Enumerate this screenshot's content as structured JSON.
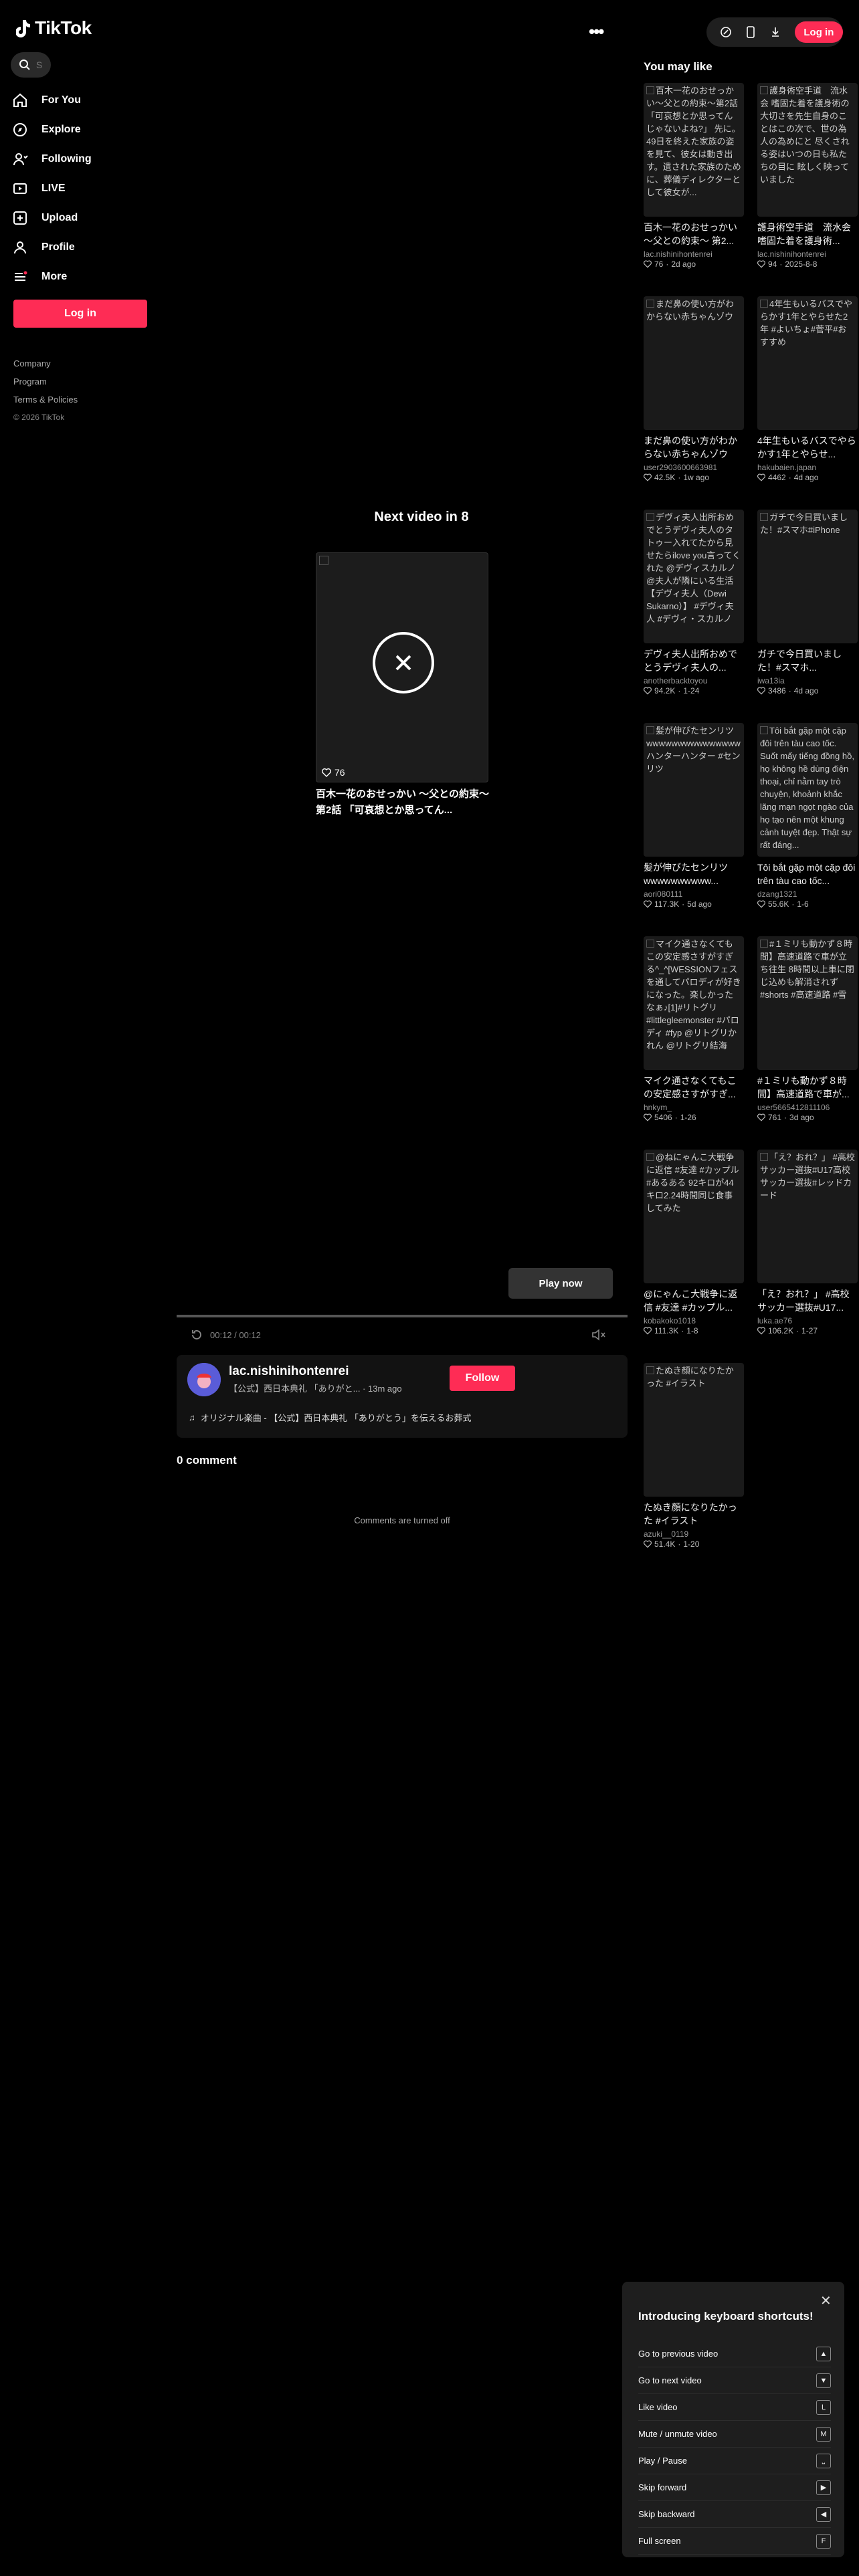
{
  "brand": {
    "name": "TikTok",
    "accent": "#fe2c55"
  },
  "search": {
    "placeholder": "S"
  },
  "nav": [
    {
      "label": "For You",
      "icon": "home-icon"
    },
    {
      "label": "Explore",
      "icon": "compass-icon"
    },
    {
      "label": "Following",
      "icon": "user-follow-icon"
    },
    {
      "label": "LIVE",
      "icon": "live-icon"
    },
    {
      "label": "Upload",
      "icon": "plus-square-icon"
    },
    {
      "label": "Profile",
      "icon": "person-icon"
    },
    {
      "label": "More",
      "icon": "more-icon"
    }
  ],
  "sidebar_login": "Log in",
  "footer": {
    "company": "Company",
    "program": "Program",
    "terms": "Terms & Policies",
    "copyright": "© 2026 TikTok"
  },
  "topbar": {
    "login": "Log in"
  },
  "next_video": {
    "title": "Next video in 8",
    "likes": "76",
    "caption": "百木一花のおせっかい 〜父との約束〜 第2話 「可哀想とか思ってん..."
  },
  "player": {
    "play_now": "Play now",
    "time": "00:12 / 00:12"
  },
  "author": {
    "name": "lac.nishinihontenrei",
    "sub": "【公式】西日本典礼 「ありがと... · 13m ago",
    "follow": "Follow",
    "music": "オリジナル楽曲 - 【公式】西日本典礼 「ありがとう」を伝えるお葬式"
  },
  "comments": {
    "title": "0 comment",
    "off": "Comments are turned off"
  },
  "you_may_like": {
    "title": "You may like",
    "cards": [
      {
        "thumb": "百木一花のおせっかい〜父との約束〜第2話「可哀想とか思ってんじゃないよね?」 先に。49日を終えた家族の姿を見て、彼女は動き出す。遺された家族のために、葬儀ディレクターとして彼女が...",
        "title": "百木一花のおせっかい 〜父との約束〜 第2...",
        "author": "lac.nishinihontenrei",
        "likes": "76",
        "date": "2d ago"
      },
      {
        "thumb": "護身術空手道　流水会 嗜固た着を護身術の大切さを先生自身のことはこの次で、世の為人の為めにと 尽くされる姿はいつの日も私たちの目に 眩しく映っていました",
        "title": "護身術空手道　流水会 嗜固た着を護身術...",
        "author": "lac.nishinihontenrei",
        "likes": "94",
        "date": "2025-8-8"
      },
      {
        "thumb": "まだ鼻の使い方がわからない赤ちゃんゾウ",
        "title": "まだ鼻の使い方がわからない赤ちゃんゾウ",
        "author": "user2903600663981",
        "likes": "42.5K",
        "date": "1w ago"
      },
      {
        "thumb": "4年生もいるバスでやらかす1年とやらせた2年 #よいちょ#菅平#おすすめ",
        "title": "4年生もいるバスでやらかす1年とやらせ...",
        "author": "hakubaien.japan",
        "likes": "4462",
        "date": "4d ago"
      },
      {
        "thumb": "デヴィ夫人出所おめでとうデヴィ夫人のタトゥー入れてたから見せたらilove you言ってくれた @デヴィスカルノ @夫人が隣にいる生活【デヴィ夫人（Dewi Sukarno）】 #デヴィ夫人 #デヴィ・スカルノ",
        "title": "デヴィ夫人出所おめでとうデヴィ夫人の...",
        "author": "anotherbacktoyou",
        "likes": "94.2K",
        "date": "1-24"
      },
      {
        "thumb": "ガチで今日買いました！#スマホ#iPhone",
        "title": "ガチで今日買いました！#スマホ...",
        "author": "iwa13ia",
        "likes": "3486",
        "date": "4d ago"
      },
      {
        "thumb": "髪が伸びたセンリツ wwwwwwwwwwwwwwwハンターハンター #センリツ",
        "title": "髪が伸びたセンリツ wwwwwwwwww...",
        "author": "aori080111",
        "likes": "117.3K",
        "date": "5d ago"
      },
      {
        "thumb": "Tôi bắt gặp một cặp đôi trên tàu cao tốc. Suốt mấy tiếng đồng hồ, họ không hề dùng điện thoại, chỉ nằm tay trò chuyện, khoảnh khắc lãng mạn ngọt ngào của họ tạo nên một khung cảnh tuyệt đẹp. Thật sự rất đáng...",
        "title": "Tôi bắt gặp một cặp đôi trên tàu cao tốc...",
        "author": "dzang1321",
        "likes": "55.6K",
        "date": "1-6"
      },
      {
        "thumb": "マイク通さなくてもこの安定感さすがすぎる^_^[WESSIONフェスを通してパロディが好きになった。楽しかったなぁ♪[1]#リトグリ #littlegleemonster #パロディ #fyp @リトグリかれん @リトグリ結海",
        "title": "マイク通さなくてもこの安定感さすがすぎ...",
        "author": "hnkym_",
        "likes": "5406",
        "date": "1-26"
      },
      {
        "thumb": "#１ミリも動かず８時間】高速道路で車が立ち往生 8時間以上車に閉じ込めも解消されず #shorts #高速道路 #雪",
        "title": "#１ミリも動かず８時間】高速道路で車が...",
        "author": "user5665412811106",
        "likes": "761",
        "date": "3d ago"
      },
      {
        "thumb": "@ねにゃんこ大戦争に返信 #友達 #カップル #あるある 92キロが44キロ2.24時間同じ食事してみた",
        "title": "@にゃんこ大戦争に返信 #友達 #カップル...",
        "author": "kobakoko1018",
        "likes": "111.3K",
        "date": "1-8"
      },
      {
        "thumb": "「え？おれ？」 #高校サッカー選抜#U17高校サッカー選抜#レッドカード",
        "title": "「え？おれ？」 #高校サッカー選抜#U17...",
        "author": "luka.ae76",
        "likes": "106.2K",
        "date": "1-27"
      },
      {
        "thumb": "たぬき顔になりたかった #イラスト",
        "title": "たぬき顔になりたかった #イラスト",
        "author": "azuki__0119",
        "likes": "51.4K",
        "date": "1-20"
      }
    ]
  },
  "shortcuts": {
    "title": "Introducing keyboard shortcuts!",
    "close": "✕",
    "items": [
      {
        "label": "Go to previous video",
        "key": "▲"
      },
      {
        "label": "Go to next video",
        "key": "▼"
      },
      {
        "label": "Like video",
        "key": "L"
      },
      {
        "label": "Mute / unmute video",
        "key": "M"
      },
      {
        "label": "Play / Pause",
        "key": "⎵"
      },
      {
        "label": "Skip forward",
        "key": "▶"
      },
      {
        "label": "Skip backward",
        "key": "◀"
      },
      {
        "label": "Full screen",
        "key": "F"
      }
    ]
  }
}
